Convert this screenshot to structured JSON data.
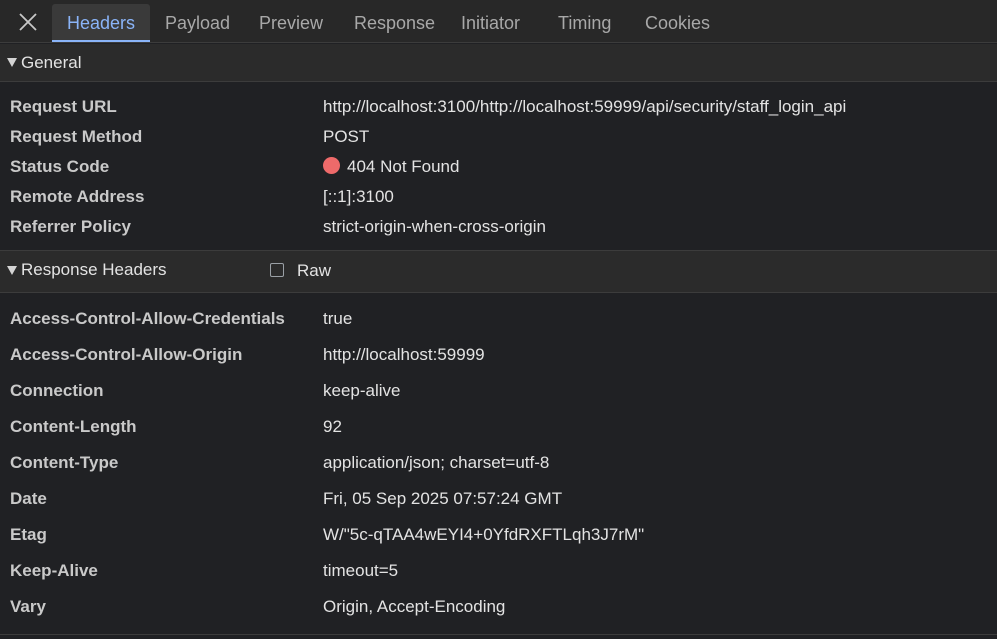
{
  "tabs": [
    {
      "label": "Headers",
      "active": true
    },
    {
      "label": "Payload"
    },
    {
      "label": "Preview"
    },
    {
      "label": "Response"
    },
    {
      "label": "Initiator"
    },
    {
      "label": "Timing"
    },
    {
      "label": "Cookies"
    }
  ],
  "general": {
    "title": "General",
    "rows": [
      {
        "key": "Request URL",
        "value": "http://localhost:3100/http://localhost:59999/api/security/staff_login_api"
      },
      {
        "key": "Request Method",
        "value": "POST"
      },
      {
        "key": "Status Code",
        "value": "404 Not Found"
      },
      {
        "key": "Remote Address",
        "value": "[::1]:3100"
      },
      {
        "key": "Referrer Policy",
        "value": "strict-origin-when-cross-origin"
      }
    ]
  },
  "response_headers": {
    "title": "Response Headers",
    "raw_label": "Raw",
    "raw_checked": false,
    "rows": [
      {
        "key": "Access-Control-Allow-Credentials",
        "value": "true"
      },
      {
        "key": "Access-Control-Allow-Origin",
        "value": "http://localhost:59999"
      },
      {
        "key": "Connection",
        "value": "keep-alive"
      },
      {
        "key": "Content-Length",
        "value": "92"
      },
      {
        "key": "Content-Type",
        "value": "application/json; charset=utf-8"
      },
      {
        "key": "Date",
        "value": "Fri, 05 Sep 2025 07:57:24 GMT"
      },
      {
        "key": "Etag",
        "value": "W/\"5c-qTAA4wEYI4+0YfdRXFTLqh3J7rM\""
      },
      {
        "key": "Keep-Alive",
        "value": "timeout=5"
      },
      {
        "key": "Vary",
        "value": "Origin, Accept-Encoding"
      }
    ]
  },
  "colors": {
    "accent": "#8ab4f8",
    "status_error": "#ee6a6a"
  }
}
